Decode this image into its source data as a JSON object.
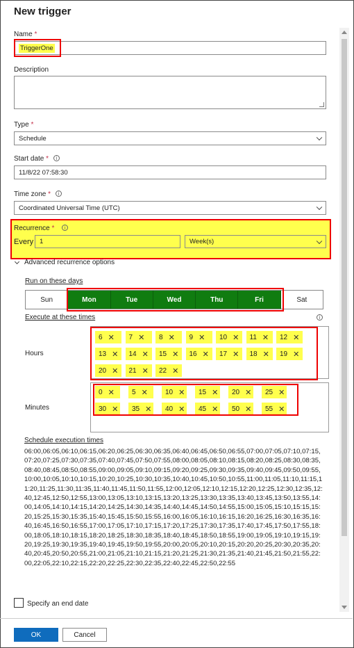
{
  "panel": {
    "title": "New trigger"
  },
  "name": {
    "label": "Name",
    "required_mark": "*",
    "value": "TriggerOne"
  },
  "description": {
    "label": "Description",
    "value": ""
  },
  "type": {
    "label": "Type",
    "required_mark": "*",
    "value": "Schedule"
  },
  "start_date": {
    "label": "Start date",
    "required_mark": "*",
    "value": "11/8/22 07:58:30"
  },
  "time_zone": {
    "label": "Time zone",
    "required_mark": "*",
    "value": "Coordinated Universal Time (UTC)"
  },
  "recurrence": {
    "label": "Recurrence",
    "required_mark": "*",
    "every_label": "Every",
    "interval": "1",
    "unit": "Week(s)"
  },
  "advanced": {
    "toggle_label": "Advanced recurrence options",
    "run_days_label": "Run on these days",
    "days": [
      {
        "label": "Sun",
        "selected": false
      },
      {
        "label": "Mon",
        "selected": true
      },
      {
        "label": "Tue",
        "selected": true
      },
      {
        "label": "Wed",
        "selected": true
      },
      {
        "label": "Thu",
        "selected": true
      },
      {
        "label": "Fri",
        "selected": true
      },
      {
        "label": "Sat",
        "selected": false
      }
    ],
    "execute_label": "Execute at these times",
    "hours_label": "Hours",
    "hours": [
      "6",
      "7",
      "8",
      "9",
      "10",
      "11",
      "12",
      "13",
      "14",
      "15",
      "16",
      "17",
      "18",
      "19",
      "20",
      "21",
      "22"
    ],
    "minutes_label": "Minutes",
    "minutes": [
      "0",
      "5",
      "10",
      "15",
      "20",
      "25",
      "30",
      "35",
      "40",
      "45",
      "50",
      "55"
    ],
    "remove_glyph": "✕"
  },
  "schedule": {
    "label": "Schedule execution times",
    "times": "06:00,06:05,06:10,06:15,06:20,06:25,06:30,06:35,06:40,06:45,06:50,06:55,07:00,07:05,07:10,07:15,07:20,07:25,07:30,07:35,07:40,07:45,07:50,07:55,08:00,08:05,08:10,08:15,08:20,08:25,08:30,08:35,08:40,08:45,08:50,08:55,09:00,09:05,09:10,09:15,09:20,09:25,09:30,09:35,09:40,09:45,09:50,09:55,10:00,10:05,10:10,10:15,10:20,10:25,10:30,10:35,10:40,10:45,10:50,10:55,11:00,11:05,11:10,11:15,11:20,11:25,11:30,11:35,11:40,11:45,11:50,11:55,12:00,12:05,12:10,12:15,12:20,12:25,12:30,12:35,12:40,12:45,12:50,12:55,13:00,13:05,13:10,13:15,13:20,13:25,13:30,13:35,13:40,13:45,13:50,13:55,14:00,14:05,14:10,14:15,14:20,14:25,14:30,14:35,14:40,14:45,14:50,14:55,15:00,15:05,15:10,15:15,15:20,15:25,15:30,15:35,15:40,15:45,15:50,15:55,16:00,16:05,16:10,16:15,16:20,16:25,16:30,16:35,16:40,16:45,16:50,16:55,17:00,17:05,17:10,17:15,17:20,17:25,17:30,17:35,17:40,17:45,17:50,17:55,18:00,18:05,18:10,18:15,18:20,18:25,18:30,18:35,18:40,18:45,18:50,18:55,19:00,19:05,19:10,19:15,19:20,19:25,19:30,19:35,19:40,19:45,19:50,19:55,20:00,20:05,20:10,20:15,20:20,20:25,20:30,20:35,20:40,20:45,20:50,20:55,21:00,21:05,21:10,21:15,21:20,21:25,21:30,21:35,21:40,21:45,21:50,21:55,22:00,22:05,22:10,22:15,22:20,22:25,22:30,22:35,22:40,22:45,22:50,22:55"
  },
  "end_date": {
    "label": "Specify an end date"
  },
  "footer": {
    "ok_label": "OK",
    "cancel_label": "Cancel"
  },
  "colors": {
    "highlight": "#ffff4d",
    "selected_day": "#107c10",
    "annotation": "#e00000",
    "primary": "#0f6cbd"
  }
}
